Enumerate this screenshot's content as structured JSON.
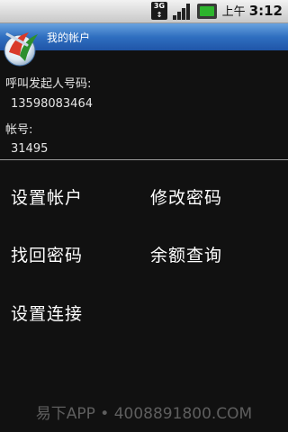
{
  "status_bar": {
    "network": "3G",
    "ampm": "上午",
    "time": "3:12"
  },
  "header": {
    "title": "我的帐户"
  },
  "info": {
    "caller_label": "呼叫发起人号码:",
    "caller_number": "13598083464",
    "account_label": "帐号:",
    "account_number": "31495"
  },
  "menu": {
    "set_account": "设置帐户",
    "change_password": "修改密码",
    "recover_password": "找回密码",
    "balance_query": "余额查询",
    "connection_settings": "设置连接"
  },
  "watermark": "易下APP • 4008891800.COM"
}
